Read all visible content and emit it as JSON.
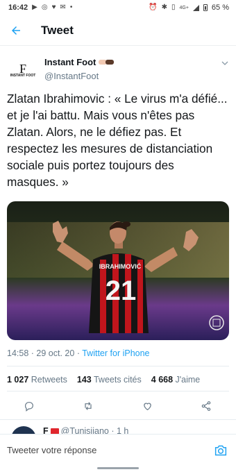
{
  "status_bar": {
    "time": "16:42",
    "network": "4G+",
    "battery": "65 %",
    "left_icons": [
      "youtube-icon",
      "messenger-icon",
      "health-icon",
      "mail-icon",
      "dot"
    ],
    "right_icons": [
      "alarm-icon",
      "bluetooth-icon",
      "vibrate-icon",
      "signal-icon",
      "battery-icon"
    ]
  },
  "header": {
    "title": "Tweet"
  },
  "tweet": {
    "author_name": "Instant Foot",
    "author_handle": "@InstantFoot",
    "avatar_letters": "F",
    "avatar_caption": "INSTANT FOOT",
    "text": "Zlatan Ibrahimovic : « Le virus m'a défié... et je l'ai battu. Mais vous n'êtes pas Zlatan. Alors, ne le défiez pas. Et respectez les mesures de distanciation sociale puis portez toujours des masques. »",
    "jersey_name": "IBRAHIMOVIĆ",
    "jersey_number": "21",
    "time": "14:58",
    "date": "29 oct. 20",
    "separator": "·",
    "source": "Twitter for iPhone"
  },
  "stats": [
    {
      "value": "1 027",
      "label": "Retweets"
    },
    {
      "value": "143",
      "label": "Tweets cités"
    },
    {
      "value": "4 668",
      "label": "J'aime"
    }
  ],
  "reply_preview": {
    "name_initial": "F",
    "handle": "@Tunisiiano",
    "time": "· 1 h"
  },
  "composer": {
    "placeholder": "Tweeter votre réponse"
  },
  "colors": {
    "accent": "#1da1f2",
    "secondary_text": "#657786"
  }
}
